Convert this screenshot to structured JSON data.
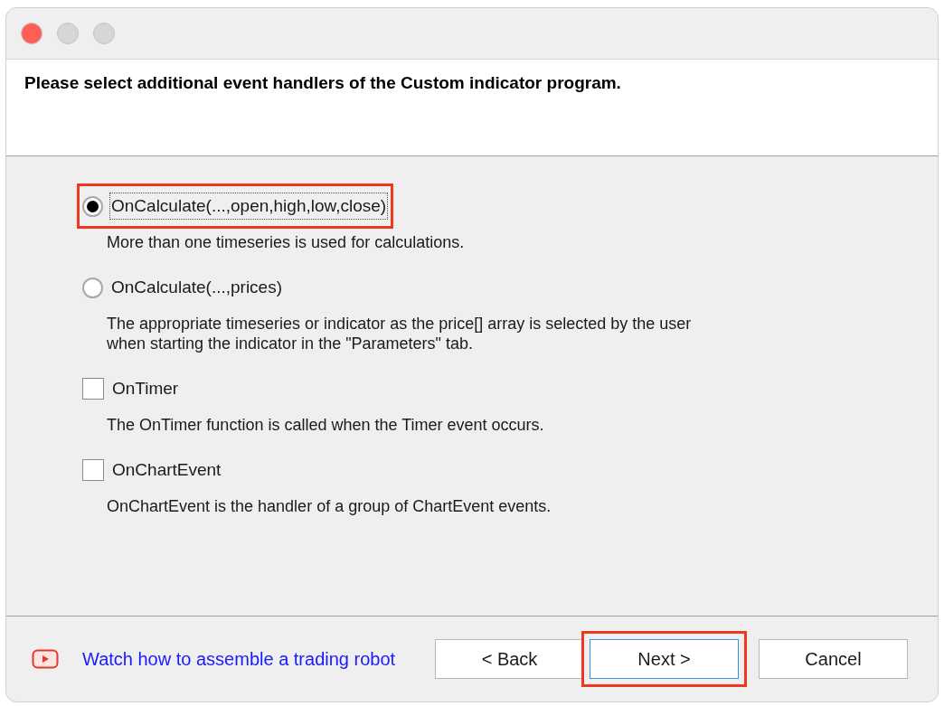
{
  "window": {
    "controls": [
      {
        "color": "#fe5f57"
      },
      {
        "color": "#d6d6d6"
      },
      {
        "color": "#d6d6d6"
      }
    ]
  },
  "header": {
    "title": "Please select additional event handlers of the Custom indicator program."
  },
  "options": [
    {
      "kind": "radio",
      "label": "OnCalculate(...,open,high,low,close)",
      "selected": true,
      "highlighted": true,
      "description": [
        "More than one timeseries is used for calculations."
      ]
    },
    {
      "kind": "radio",
      "label": "OnCalculate(...,prices)",
      "selected": false,
      "highlighted": false,
      "description": [
        "The appropriate timeseries or indicator as the price[] array is selected by the user",
        "when starting the indicator in the \"Parameters\" tab."
      ]
    },
    {
      "kind": "checkbox",
      "label": "OnTimer",
      "checked": false,
      "highlighted": false,
      "description": [
        "The OnTimer function is called when the Timer event occurs."
      ]
    },
    {
      "kind": "checkbox",
      "label": "OnChartEvent",
      "checked": false,
      "highlighted": false,
      "description": [
        "OnChartEvent is the handler of a group of ChartEvent events."
      ]
    }
  ],
  "footer": {
    "link": "Watch how to assemble a trading robot",
    "buttons": [
      {
        "label": "< Back",
        "focused": false,
        "highlighted": false
      },
      {
        "label": "Next >",
        "focused": true,
        "highlighted": true
      },
      {
        "label": "Cancel",
        "focused": false,
        "highlighted": false
      }
    ]
  }
}
